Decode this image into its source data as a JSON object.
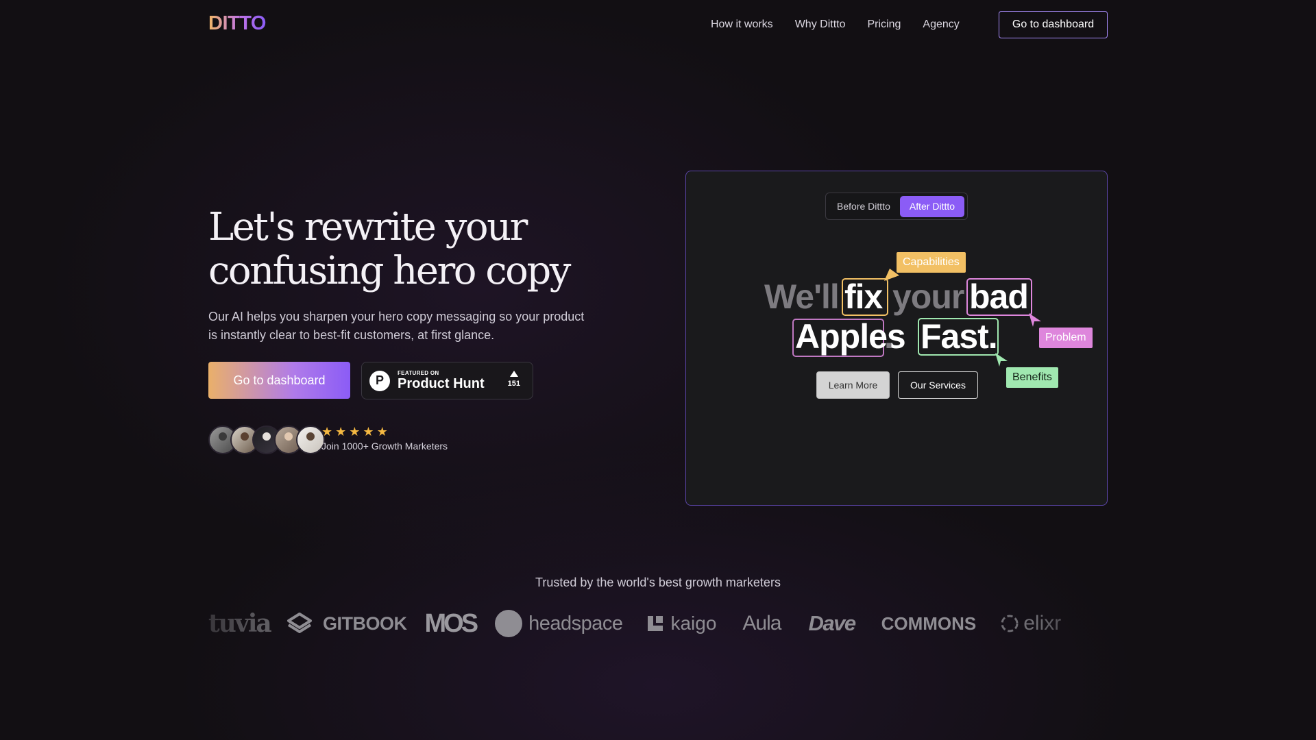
{
  "brand": {
    "logo_text": "DITTO"
  },
  "nav": {
    "links": [
      "How it works",
      "Why Dittto",
      "Pricing",
      "Agency"
    ],
    "cta_label": "Go to dashboard"
  },
  "hero": {
    "title": "Let's rewrite your confusing hero copy",
    "subtitle": "Our AI helps you sharpen your hero copy messaging so your product is instantly clear to best-fit customers, at first glance.",
    "cta_label": "Go to dashboard",
    "product_hunt": {
      "small": "FEATURED ON",
      "big": "Product Hunt",
      "logo": "P",
      "upvotes": "151"
    },
    "rating": {
      "stars": 5,
      "star_glyph": "★",
      "text": "Join 1000+ Growth Marketers"
    }
  },
  "demo": {
    "toggle": {
      "before": "Before Dittto",
      "after": "After Dittto",
      "active": "after"
    },
    "words": {
      "w1": "We'll",
      "w2": "fix",
      "w3": "your",
      "w4": "bad",
      "w5": "Apples",
      "dot": ".",
      "w6": "Fast."
    },
    "tags": {
      "capabilities": "Capabilities",
      "problem": "Problem",
      "benefits": "Benefits"
    },
    "buttons": {
      "learn_more": "Learn More",
      "our_services": "Our Services"
    },
    "colors": {
      "capabilities": "#f2c064",
      "problem": "#de86dc",
      "benefits": "#a0e8b0",
      "apples": "#c078c2",
      "accent": "#8b5cf6"
    }
  },
  "trusted": {
    "heading": "Trusted by the world's best growth marketers",
    "logos": [
      "tuvia",
      "GITBOOK",
      "MOS",
      "headspace",
      "kaigo",
      "Aula",
      "Dave",
      "COMMONS",
      "elixr"
    ]
  }
}
